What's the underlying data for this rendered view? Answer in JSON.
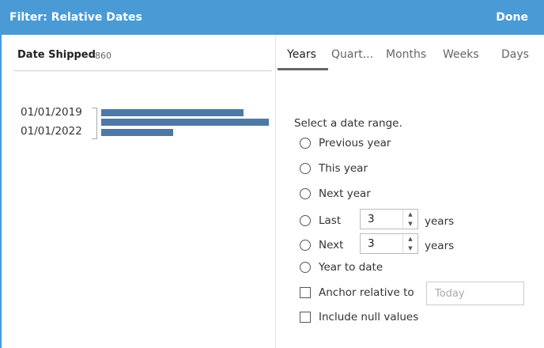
{
  "header": {
    "title": "Filter: Relative Dates",
    "done_label": "Done"
  },
  "field": {
    "name": "Date Shipped",
    "count": "860"
  },
  "histogram": {
    "labels": [
      "01/01/2019",
      "01/01/2022"
    ],
    "bars": [
      {
        "relative_value": 0.85
      },
      {
        "relative_value": 1.0
      },
      {
        "relative_value": 0.43
      }
    ],
    "color": "#4e79a7"
  },
  "tabs": [
    {
      "label": "Years",
      "active": true
    },
    {
      "label": "Quart...",
      "active": false
    },
    {
      "label": "Months",
      "active": false
    },
    {
      "label": "Weeks",
      "active": false
    },
    {
      "label": "Days",
      "active": false
    }
  ],
  "range": {
    "prompt": "Select a date range.",
    "previous": "Previous year",
    "this": "This year",
    "next": "Next year",
    "last": {
      "label": "Last",
      "value": "3",
      "unit": "years"
    },
    "next_n": {
      "label": "Next",
      "value": "3",
      "unit": "years"
    },
    "to_date": "Year to date"
  },
  "anchor": {
    "label": "Anchor relative to",
    "placeholder": "Today"
  },
  "include_null": {
    "label": "Include null values"
  },
  "colors": {
    "header_bg": "#4a9ad6",
    "bar": "#4e79a7"
  }
}
